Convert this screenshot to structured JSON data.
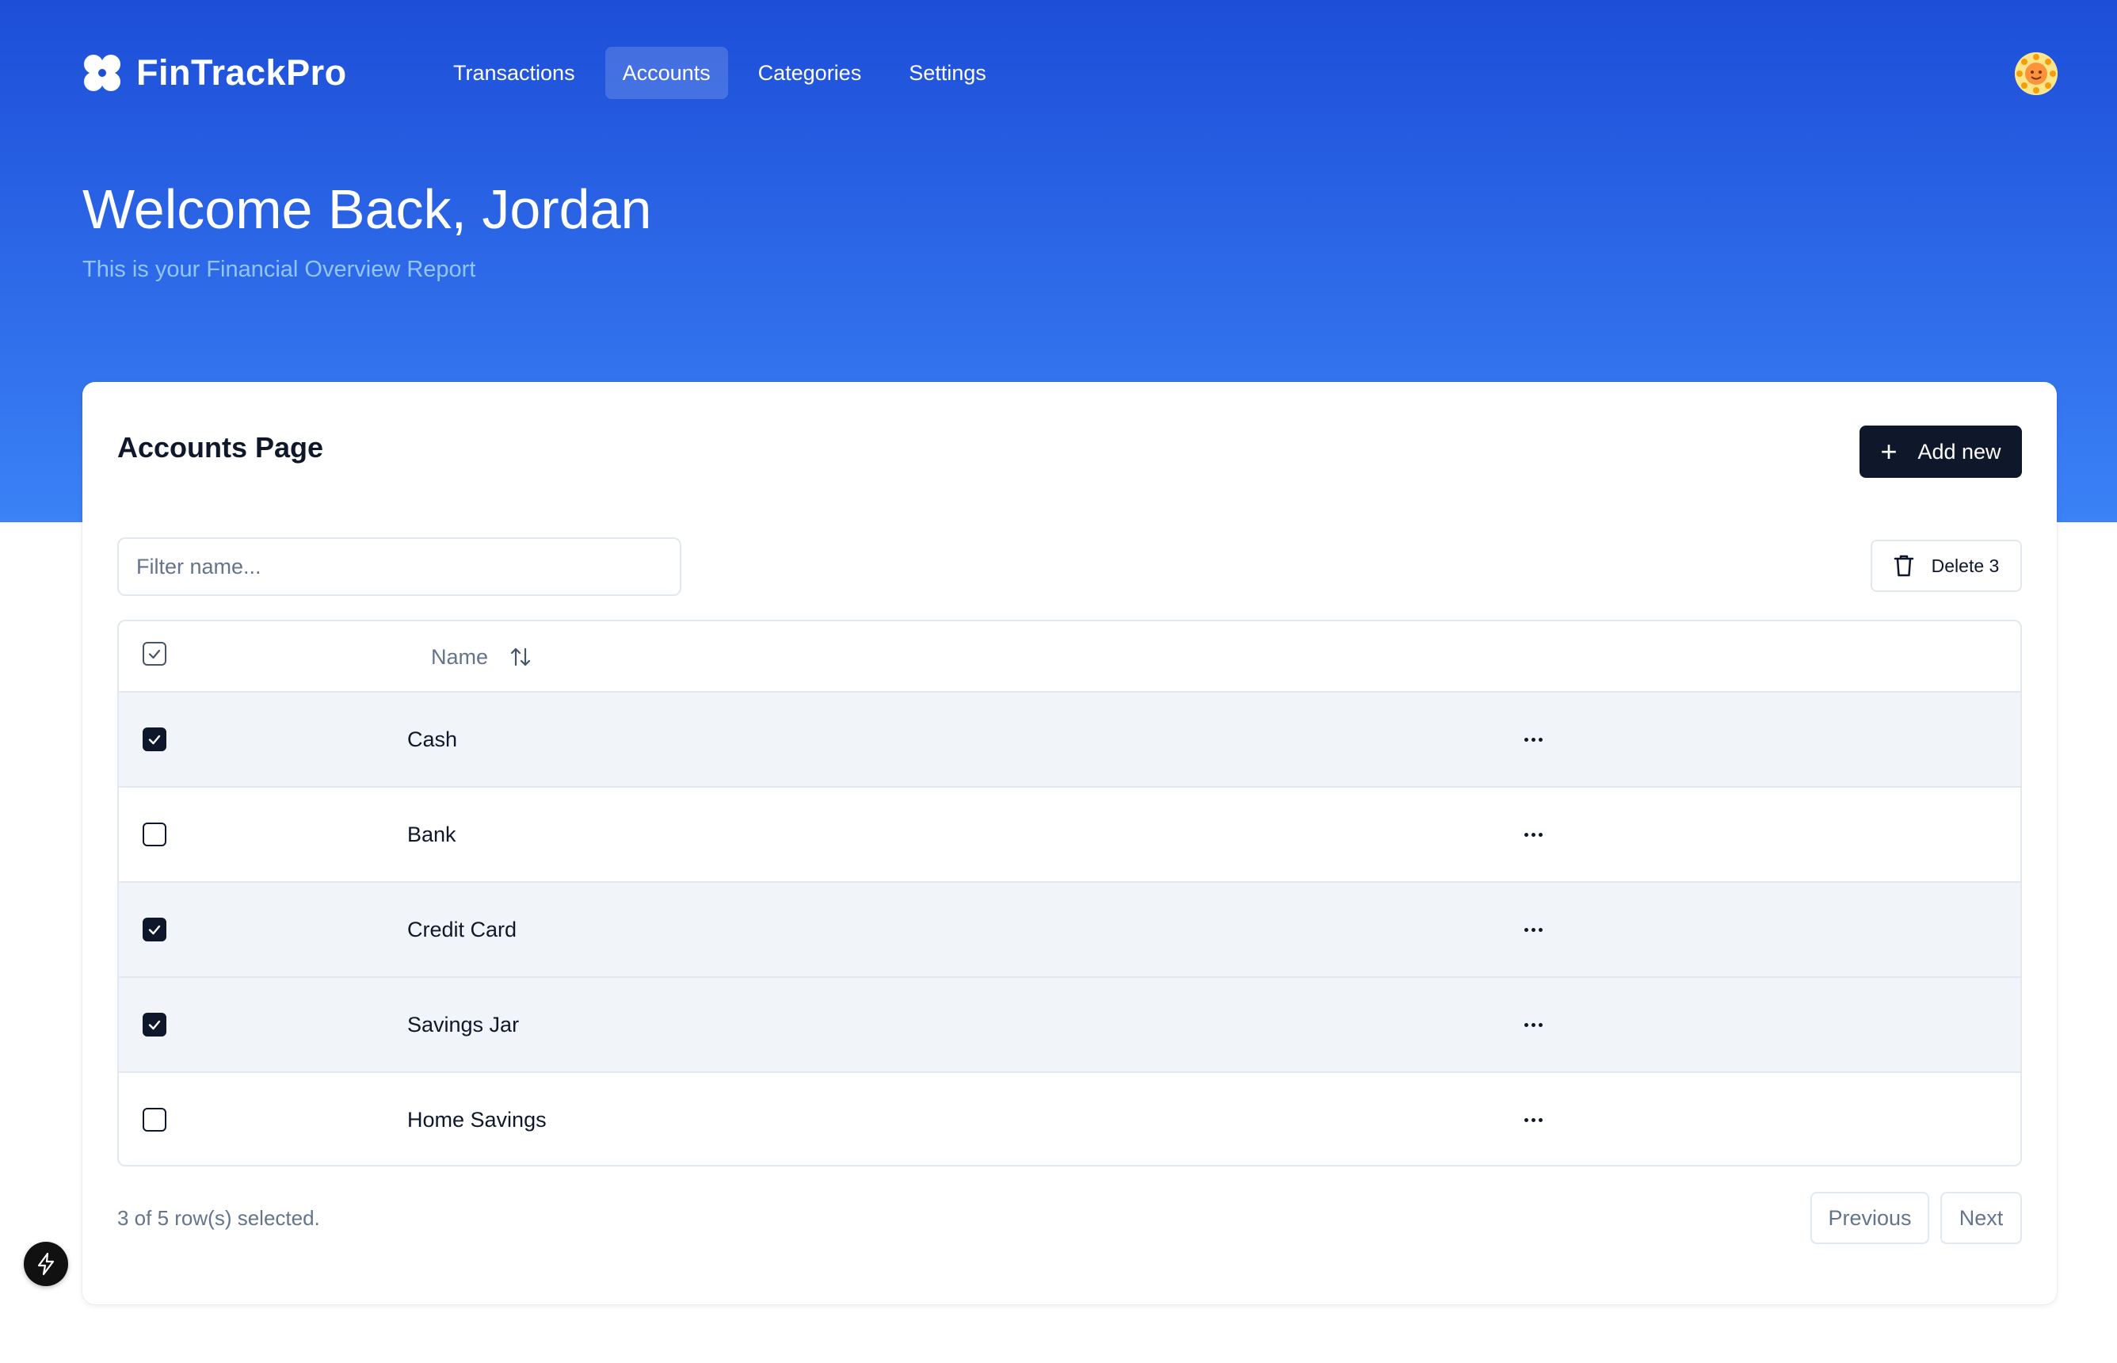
{
  "app": {
    "name": "FinTrackPro",
    "logo_icon": "clover-icon"
  },
  "nav": {
    "items": [
      {
        "label": "Transactions",
        "active": false
      },
      {
        "label": "Accounts",
        "active": true
      },
      {
        "label": "Categories",
        "active": false
      },
      {
        "label": "Settings",
        "active": false
      }
    ]
  },
  "user": {
    "avatar_icon": "avatar-icon"
  },
  "hero": {
    "welcome": "Welcome Back, Jordan",
    "subtitle": "This is your Financial Overview Report"
  },
  "page": {
    "title": "Accounts Page",
    "add_button_label": "Add new",
    "filter_placeholder": "Filter name...",
    "filter_value": "",
    "delete_button_label": "Delete 3"
  },
  "table": {
    "column_header": "Name",
    "header_checkbox_state": "partial",
    "rows": [
      {
        "name": "Cash",
        "selected": true
      },
      {
        "name": "Bank",
        "selected": false
      },
      {
        "name": "Credit Card",
        "selected": true
      },
      {
        "name": "Savings Jar",
        "selected": true
      },
      {
        "name": "Home Savings",
        "selected": false
      }
    ]
  },
  "footer": {
    "selection_text": "3 of 5 row(s) selected.",
    "previous_label": "Previous",
    "next_label": "Next"
  },
  "colors": {
    "hero_top": "#1d4ed8",
    "hero_bottom": "#3b82f6",
    "primary_dark": "#0f172a",
    "row_selected_bg": "#f1f5f9",
    "muted_text": "#64748b",
    "border": "#e2e8f0"
  }
}
